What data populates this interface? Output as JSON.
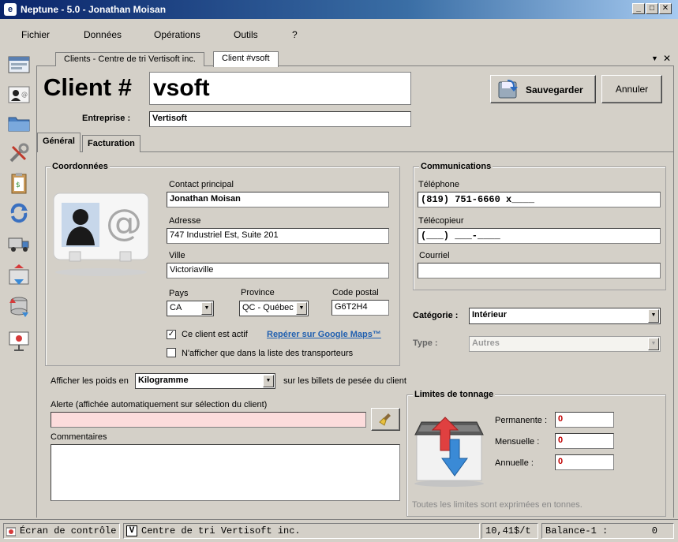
{
  "window": {
    "title": "Neptune - 5.0 - Jonathan Moisan",
    "icon_letter": "e"
  },
  "menu": [
    "Fichier",
    "Données",
    "Opérations",
    "Outils",
    "?"
  ],
  "doc_tabs": [
    {
      "label": "Clients - Centre de tri Vertisoft inc."
    },
    {
      "label": "Client #vsoft"
    }
  ],
  "header": {
    "client_label": "Client #",
    "client_id": "vsoft",
    "entreprise_label": "Entreprise :",
    "entreprise_value": "Vertisoft"
  },
  "actions": {
    "save": "Sauvegarder",
    "cancel": "Annuler"
  },
  "inner_tabs": [
    "Général",
    "Facturation"
  ],
  "coordonnees": {
    "title": "Coordonnées",
    "contact_label": "Contact principal",
    "contact_value": "Jonathan Moisan",
    "adresse_label": "Adresse",
    "adresse_value": "747 Industriel Est, Suite 201",
    "ville_label": "Ville",
    "ville_value": "Victoriaville",
    "pays_label": "Pays",
    "pays_value": "CA",
    "province_label": "Province",
    "province_value": "QC - Québec",
    "postal_label": "Code postal",
    "postal_value": "G6T2H4",
    "actif_label": "Ce client est actif",
    "actif_checked": true,
    "maps_link": "Repérer sur Google Maps™",
    "transport_label": "N'afficher que dans la liste des transporteurs",
    "transport_checked": false
  },
  "communications": {
    "title": "Communications",
    "tel_label": "Téléphone",
    "tel_value": "(819) 751-6660  x____",
    "fax_label": "Télécopieur",
    "fax_value": "(___) ___-____",
    "courriel_label": "Courriel",
    "courriel_value": ""
  },
  "categorie": {
    "label": "Catégorie :",
    "value": "Intérieur"
  },
  "type": {
    "label": "Type :",
    "value": "Autres"
  },
  "poids": {
    "prefix": "Afficher les poids en",
    "value": "Kilogramme",
    "suffix": "sur les billets de pesée du client"
  },
  "alerte": {
    "label": "Alerte (affichée automatiquement sur sélection du client)",
    "value": ""
  },
  "commentaires": {
    "label": "Commentaires",
    "value": ""
  },
  "limites": {
    "title": "Limites de tonnage",
    "permanente_label": "Permanente :",
    "permanente_value": "0",
    "mensuelle_label": "Mensuelle :",
    "mensuelle_value": "0",
    "annuelle_label": "Annuelle :",
    "annuelle_value": "0",
    "note": "Toutes les limites sont exprimées en tonnes."
  },
  "status": {
    "controle": "Écran de contrôle",
    "centre_letter": "V",
    "centre": "Centre de tri Vertisoft inc.",
    "prix": "10,41$/t",
    "balance": "Balance-1 :",
    "balance_value": "0"
  },
  "colors": {
    "alert_bg": "#fcdcdc",
    "limit_value": "#c00000",
    "link": "#1f5fb0"
  }
}
